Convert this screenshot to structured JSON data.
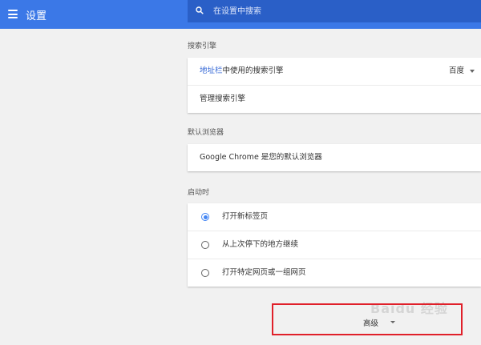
{
  "header": {
    "title": "设置",
    "search_placeholder": "在设置中搜索"
  },
  "search_engine": {
    "section_title": "搜索引擎",
    "row1_link": "地址栏",
    "row1_text": "中使用的搜索引擎",
    "row1_value": "百度",
    "row2_label": "管理搜索引擎"
  },
  "default_browser": {
    "section_title": "默认浏览器",
    "status": "Google Chrome 是您的默认浏览器"
  },
  "startup": {
    "section_title": "启动时",
    "options": [
      {
        "label": "打开新标签页",
        "checked": true
      },
      {
        "label": "从上次停下的地方继续",
        "checked": false
      },
      {
        "label": "打开特定网页或一组网页",
        "checked": false
      }
    ]
  },
  "advanced": {
    "label": "高级"
  },
  "watermark": {
    "text": "Baidu 经验"
  },
  "colors": {
    "header": "#3b78e7",
    "search_bg": "#2a5fc7",
    "accent": "#4285f4",
    "highlight_box": "#e0202a"
  }
}
